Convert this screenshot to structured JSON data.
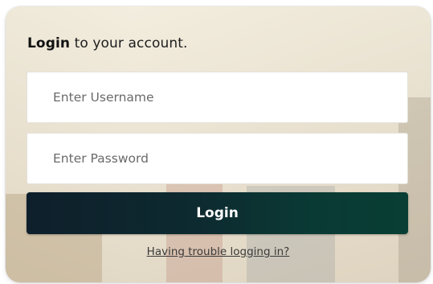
{
  "form": {
    "heading_bold": "Login",
    "heading_rest": " to your account.",
    "username": {
      "placeholder": "Enter Username",
      "value": ""
    },
    "password": {
      "placeholder": "Enter Password",
      "value": ""
    },
    "login_label": "Login",
    "trouble_link": "Having trouble logging in?"
  },
  "colors": {
    "button_start": "#0e1f2b",
    "button_end": "#083e33",
    "heading_text": "#1d1d1d"
  }
}
